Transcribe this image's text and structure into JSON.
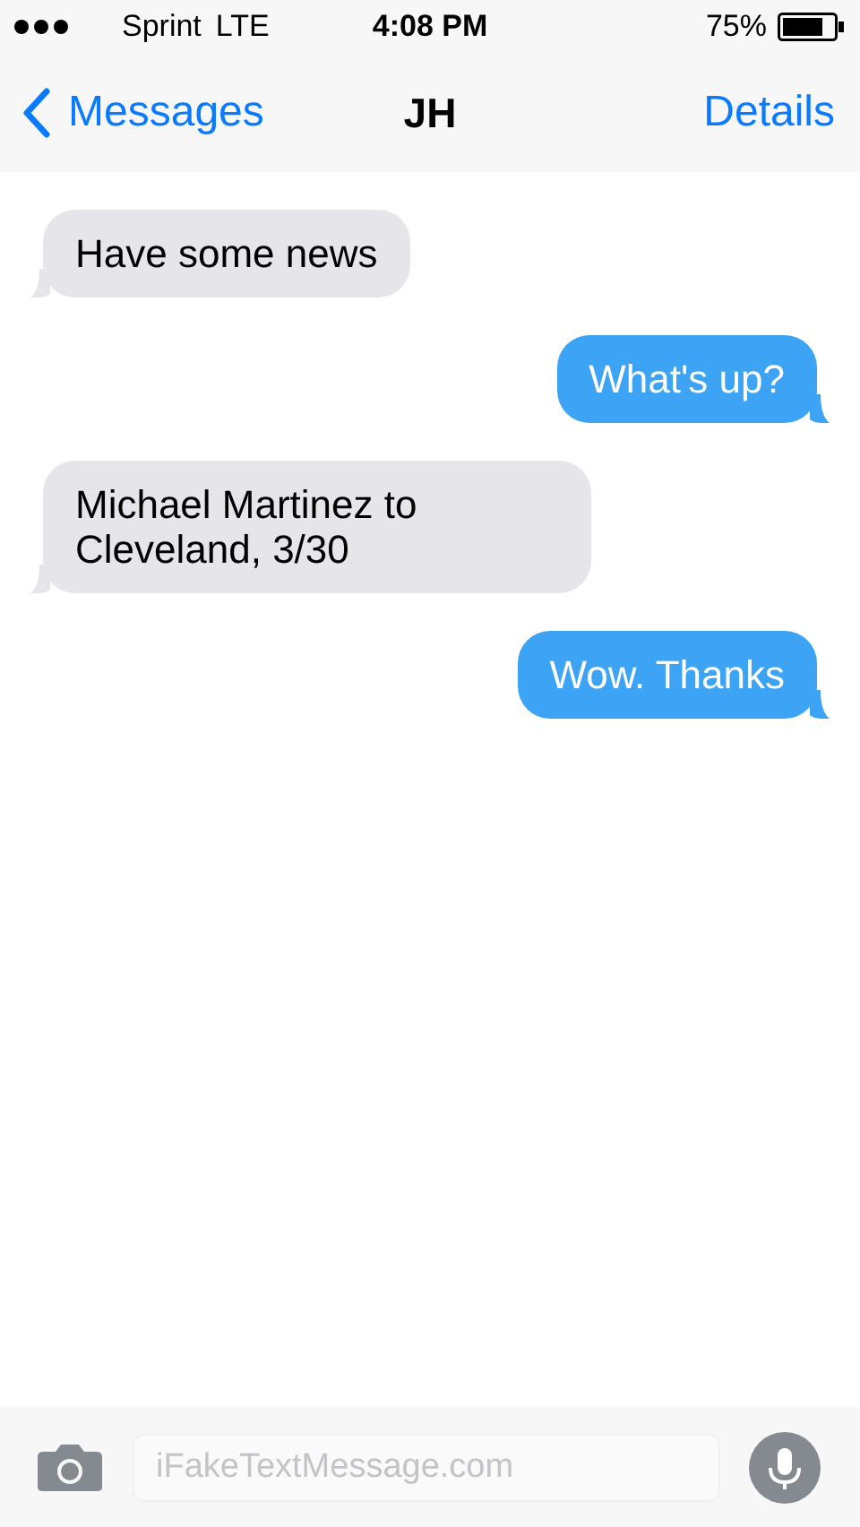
{
  "status_bar": {
    "carrier": "Sprint",
    "network": "LTE",
    "time": "4:08 PM",
    "battery": "75%"
  },
  "nav_bar": {
    "back": "Messages",
    "title": "JH",
    "action": "Details"
  },
  "messages": [
    {
      "text": "Have some news",
      "kind": "received"
    },
    {
      "text": "What's up?",
      "kind": "sent"
    },
    {
      "text": "Michael Martinez to Cleveland, 3/30",
      "kind": "received"
    },
    {
      "text": "Wow. Thanks",
      "kind": "sent"
    }
  ],
  "composer": {
    "placeholder": "iFakeTextMessage.com"
  }
}
